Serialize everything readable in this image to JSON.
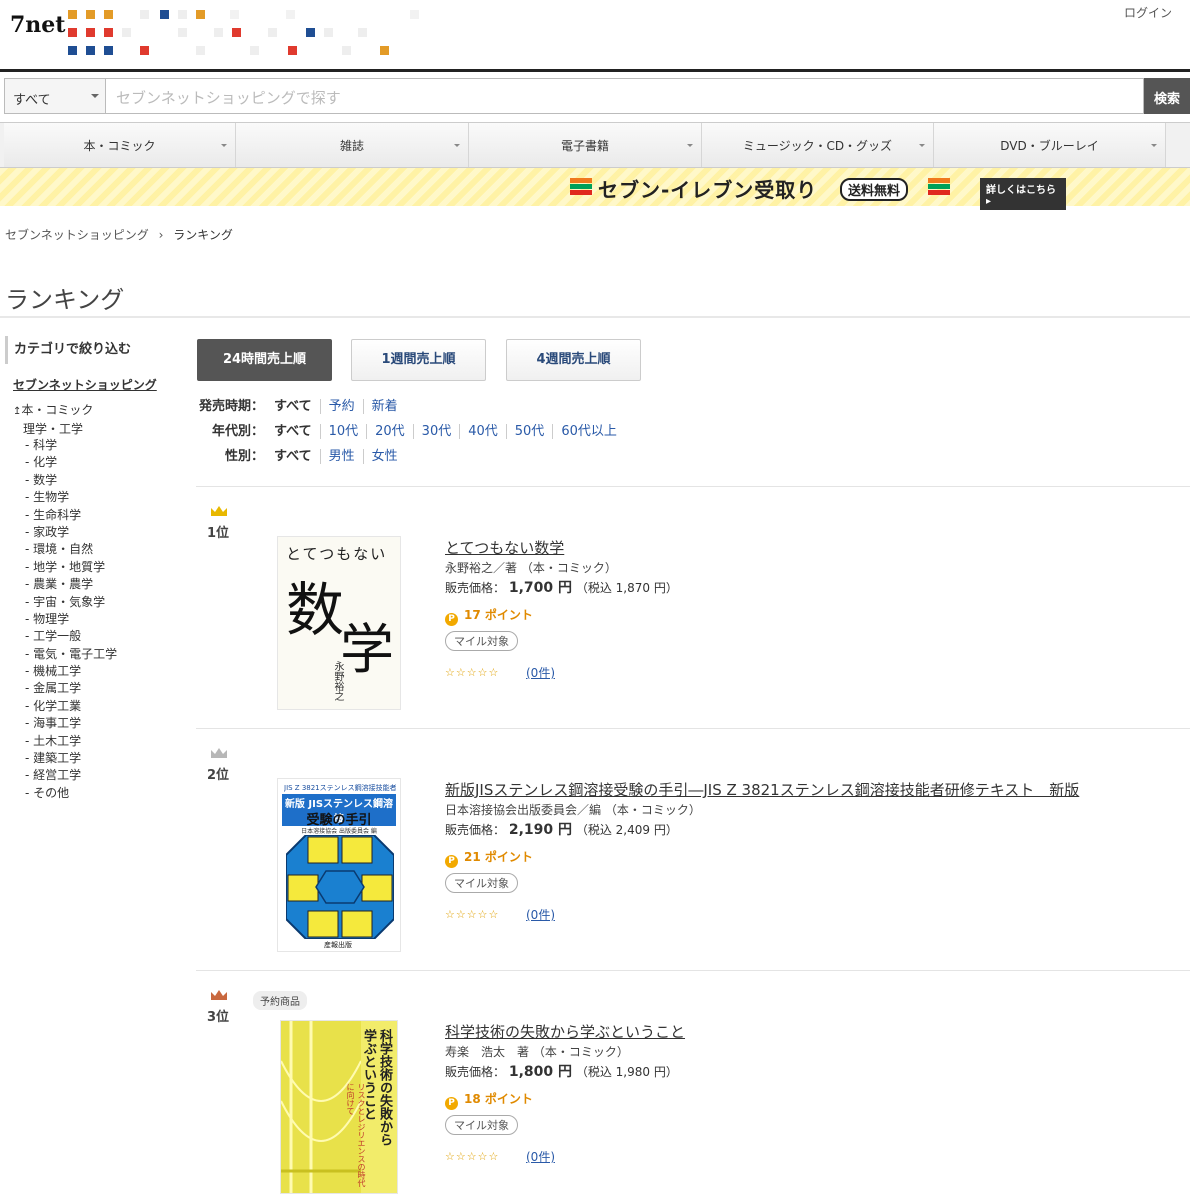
{
  "header": {
    "logo_text": "7net",
    "login_label": "ログイン"
  },
  "search": {
    "category": "すべて",
    "placeholder": "セブンネットショッピングで探す",
    "button_label": "検索"
  },
  "nav": [
    "本・コミック",
    "雑誌",
    "電子書籍",
    "ミュージック・CD・グッズ",
    "DVD・ブルーレイ"
  ],
  "banner": {
    "text": "セブン-イレブン受取り",
    "free": "送料無料",
    "more": "詳しくはこちら ▸",
    "colors": {
      "orange": "#f0781e",
      "green": "#00a05a",
      "red": "#e0281e"
    }
  },
  "breadcrumb": {
    "home": "セブンネットショッピング",
    "sep": "›",
    "current": "ランキング"
  },
  "page_title": "ランキング",
  "sidebar": {
    "heading": "カテゴリで絞り込む",
    "root": "セブンネットショッピング",
    "parent": "本・コミック",
    "sub": "理学・工学",
    "items": [
      "科学",
      "化学",
      "数学",
      "生物学",
      "生命科学",
      "家政学",
      "環境・自然",
      "地学・地質学",
      "農業・農学",
      "宇宙・気象学",
      "物理学",
      "工学一般",
      "電気・電子工学",
      "機械工学",
      "金属工学",
      "化学工業",
      "海事工学",
      "土木工学",
      "建築工学",
      "経営工学",
      "その他"
    ]
  },
  "tabs": [
    "24時間売上順",
    "1週間売上順",
    "4週間売上順"
  ],
  "filters": [
    {
      "label": "発売時期：",
      "options": [
        "すべて",
        "予約",
        "新着"
      ]
    },
    {
      "label": "年代別：",
      "options": [
        "すべて",
        "10代",
        "20代",
        "30代",
        "40代",
        "50代",
        "60代以上"
      ]
    },
    {
      "label": "性別：",
      "options": [
        "すべて",
        "男性",
        "女性"
      ]
    }
  ],
  "products": [
    {
      "rank": "1位",
      "title": "とてつもない数学",
      "author": "永野裕之／著 （本・コミック）",
      "price_label": "販売価格：",
      "price": "1,700 円",
      "tax": "（税込 1,870 円）",
      "points": "17 ポイント",
      "mile": "マイル対象",
      "stars": "☆☆☆☆☆",
      "reviews": "(0件)",
      "cover": {
        "line1": "とてつもない",
        "big1": "数",
        "big2": "学",
        "author": "永野裕之"
      }
    },
    {
      "rank": "2位",
      "title": "新版JISステンレス鋼溶接受験の手引―JIS Z 3821ステンレス鋼溶接技能者研修テキスト　新版",
      "author": "日本溶接協会出版委員会／編 （本・コミック）",
      "price_label": "販売価格：",
      "price": "2,190 円",
      "tax": "（税込 2,409 円）",
      "points": "21 ポイント",
      "mile": "マイル対象",
      "stars": "☆☆☆☆☆",
      "reviews": "(0件)",
      "cover": {
        "line1": "JIS Z 3821ステンレス鋼溶接技能者研修テキスト",
        "line2": "新版 JISステンレス鋼溶接",
        "line3": "受験の手引",
        "line4": "日本溶接協会 出版委員会 編",
        "publisher": "産報出版"
      }
    },
    {
      "rank": "3位",
      "badge": "予約商品",
      "title": "科学技術の失敗から学ぶということ",
      "author": "寿楽　浩太　著 （本・コミック）",
      "price_label": "販売価格：",
      "price": "1,800 円",
      "tax": "（税込 1,980 円）",
      "points": "18 ポイント",
      "mile": "マイル対象",
      "stars": "☆☆☆☆☆",
      "reviews": "(0件)",
      "cover": {
        "title_a": "科学技術の失敗から",
        "title_b": "学ぶということ",
        "sub": "リスクとレジリエンスの時代に向けて"
      }
    }
  ]
}
